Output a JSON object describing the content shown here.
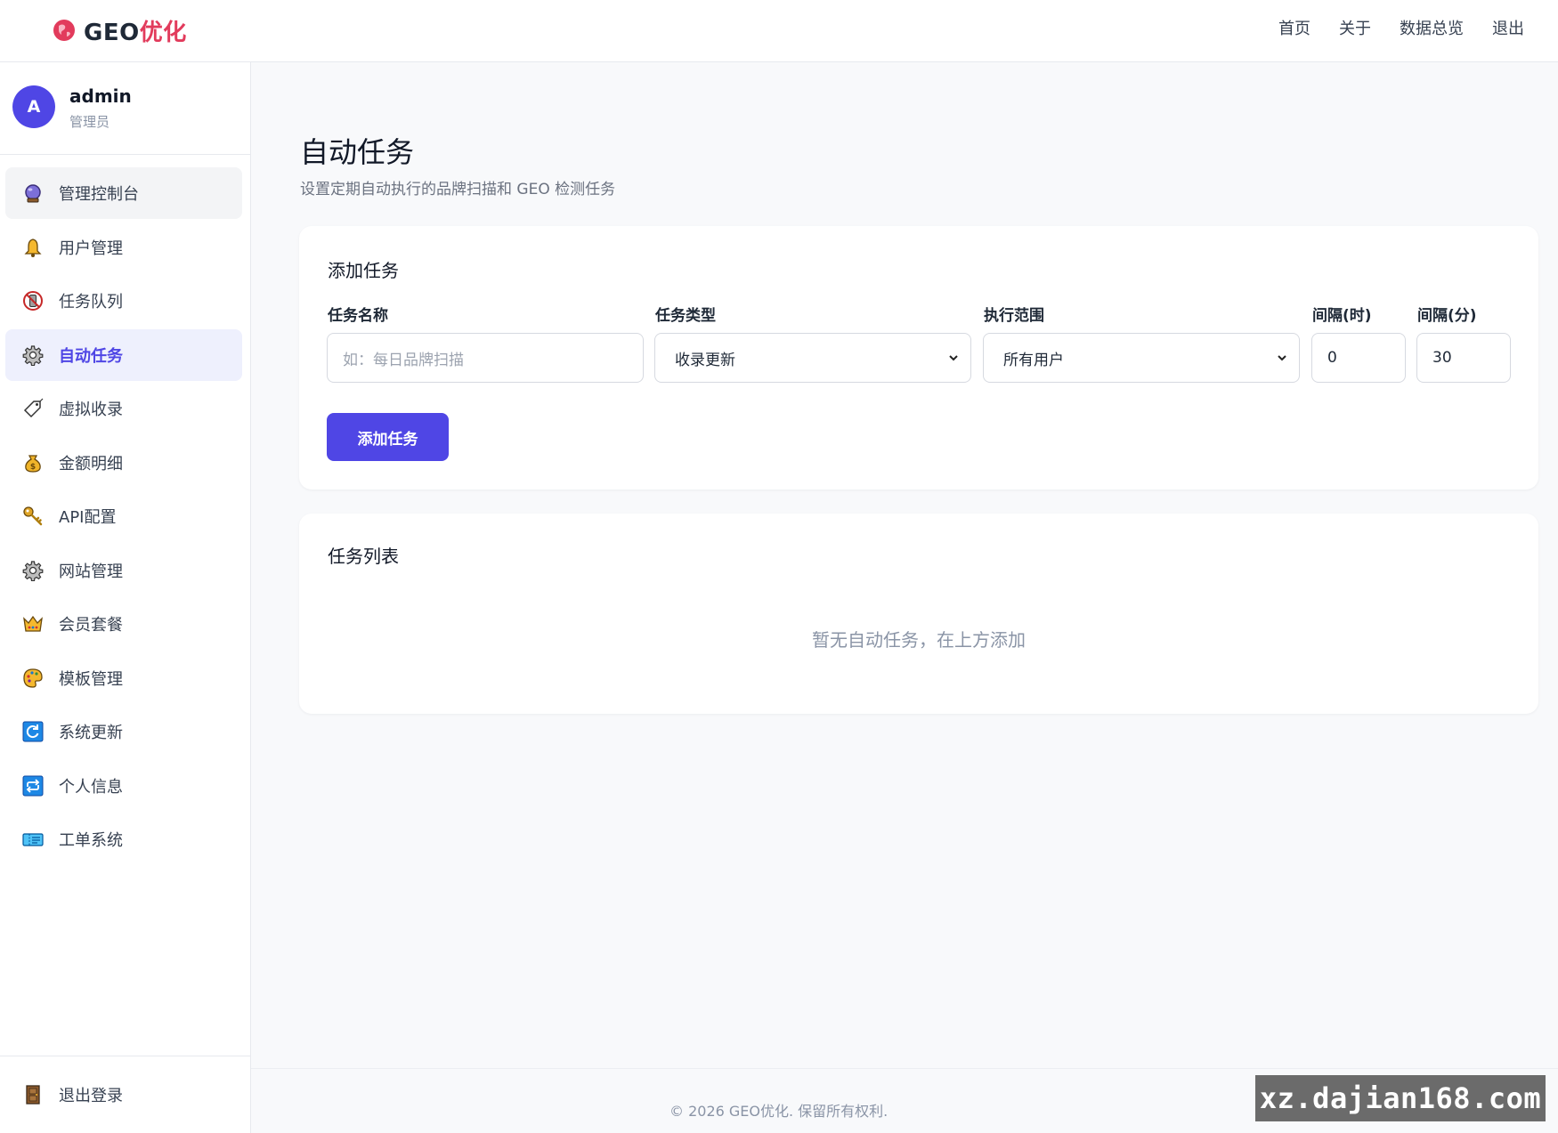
{
  "brand": {
    "name_prefix": "GEO",
    "name_accent": "优化",
    "logo_icon": "globe-heart-icon"
  },
  "topnav": {
    "items": [
      "首页",
      "关于",
      "数据总览",
      "退出"
    ]
  },
  "user": {
    "avatar_initial": "A",
    "name": "admin",
    "role": "管理员"
  },
  "sidebar": {
    "items": [
      {
        "label": "管理控制台",
        "icon": "crystal-ball-icon"
      },
      {
        "label": "用户管理",
        "icon": "bell-icon"
      },
      {
        "label": "任务队列",
        "icon": "no-phone-icon"
      },
      {
        "label": "自动任务",
        "icon": "gear-icon",
        "active": true
      },
      {
        "label": "虚拟收录",
        "icon": "tag-icon"
      },
      {
        "label": "金额明细",
        "icon": "money-bag-icon"
      },
      {
        "label": "API配置",
        "icon": "key-icon"
      },
      {
        "label": "网站管理",
        "icon": "gear-icon"
      },
      {
        "label": "会员套餐",
        "icon": "crown-icon"
      },
      {
        "label": "模板管理",
        "icon": "palette-icon"
      },
      {
        "label": "系统更新",
        "icon": "refresh-icon"
      },
      {
        "label": "个人信息",
        "icon": "repeat-icon"
      },
      {
        "label": "工单系统",
        "icon": "ticket-icon"
      }
    ],
    "logout_label": "退出登录",
    "logout_icon": "door-icon"
  },
  "page": {
    "title": "自动任务",
    "subtitle": "设置定期自动执行的品牌扫描和 GEO 检测任务"
  },
  "add_task": {
    "title": "添加任务",
    "fields": {
      "name_label": "任务名称",
      "name_placeholder": "如：每日品牌扫描",
      "type_label": "任务类型",
      "type_value": "收录更新",
      "scope_label": "执行范围",
      "scope_value": "所有用户",
      "hours_label": "间隔(时)",
      "hours_value": "0",
      "minutes_label": "间隔(分)",
      "minutes_value": "30"
    },
    "submit_label": "添加任务"
  },
  "task_list": {
    "title": "任务列表",
    "empty_text": "暂无自动任务，在上方添加"
  },
  "footer": {
    "copyright": "© 2026 GEO优化. 保留所有权利."
  },
  "watermark": {
    "text": "xz.dajian168.com"
  },
  "colors": {
    "accent": "#4f46e5",
    "brand_accent": "#e23b5c"
  }
}
